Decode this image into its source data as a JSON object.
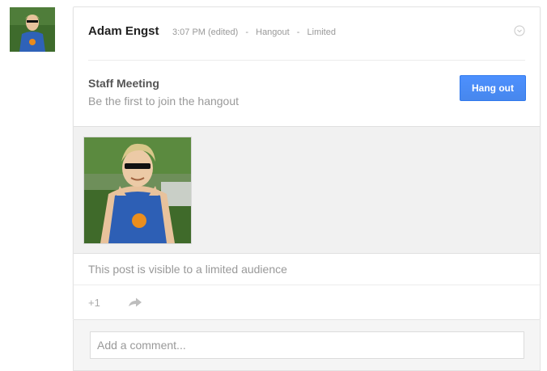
{
  "post": {
    "author": "Adam Engst",
    "time": "3:07 PM (edited)",
    "separator": "-",
    "type": "Hangout",
    "visibility_tag": "Limited"
  },
  "hangout": {
    "title": "Staff Meeting",
    "subtitle": "Be the first to join the hangout",
    "button_label": "Hang out"
  },
  "footer": {
    "visibility_note": "This post is visible to a limited audience",
    "plus_one": "+1"
  },
  "comment": {
    "placeholder": "Add a comment..."
  },
  "icons": {
    "menu": "chevron-down-circle-icon",
    "share": "share-arrow-icon"
  },
  "colors": {
    "button": "#4d90fe",
    "author_text": "#222222",
    "muted_text": "#999999"
  }
}
